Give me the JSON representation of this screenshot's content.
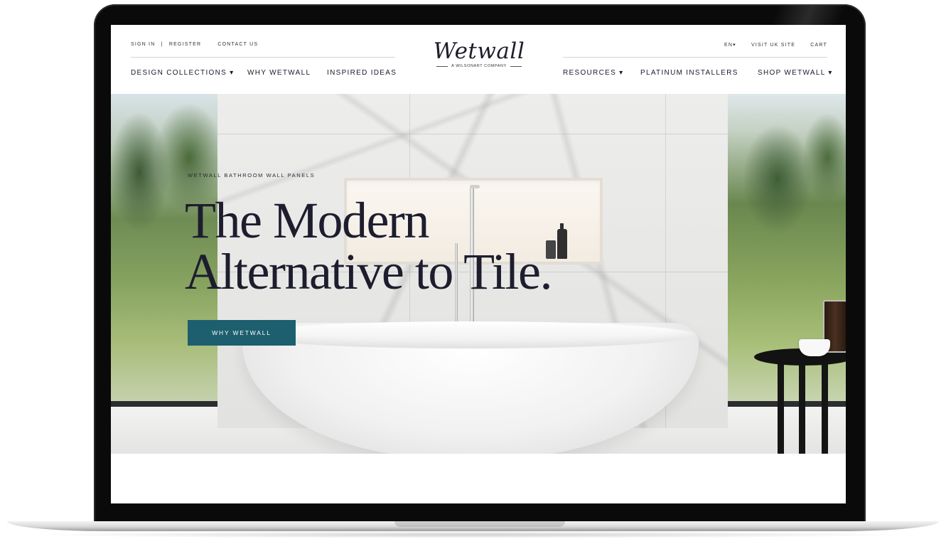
{
  "header": {
    "utility_left": [
      "SIGN IN",
      "|",
      "REGISTER",
      "CONTACT US"
    ],
    "utility_right": [
      "EN▾",
      "VISIT UK SITE",
      "CART"
    ],
    "logo": {
      "word": "Wetwall",
      "tag": "A WILSONART COMPANY"
    },
    "nav_left": [
      "DESIGN COLLECTIONS ▾",
      "WHY WETWALL",
      "INSPIRED IDEAS"
    ],
    "nav_right": [
      "RESOURCES ▾",
      "PLATINUM INSTALLERS",
      "SHOP WETWALL ▾"
    ]
  },
  "hero": {
    "eyebrow": "WETWALL BATHROOM WALL PANELS",
    "headline_line1": "The Modern",
    "headline_line2": "Alternative to Tile.",
    "cta_label": "WHY WETWALL",
    "cta_color": "#1d5f6e"
  }
}
